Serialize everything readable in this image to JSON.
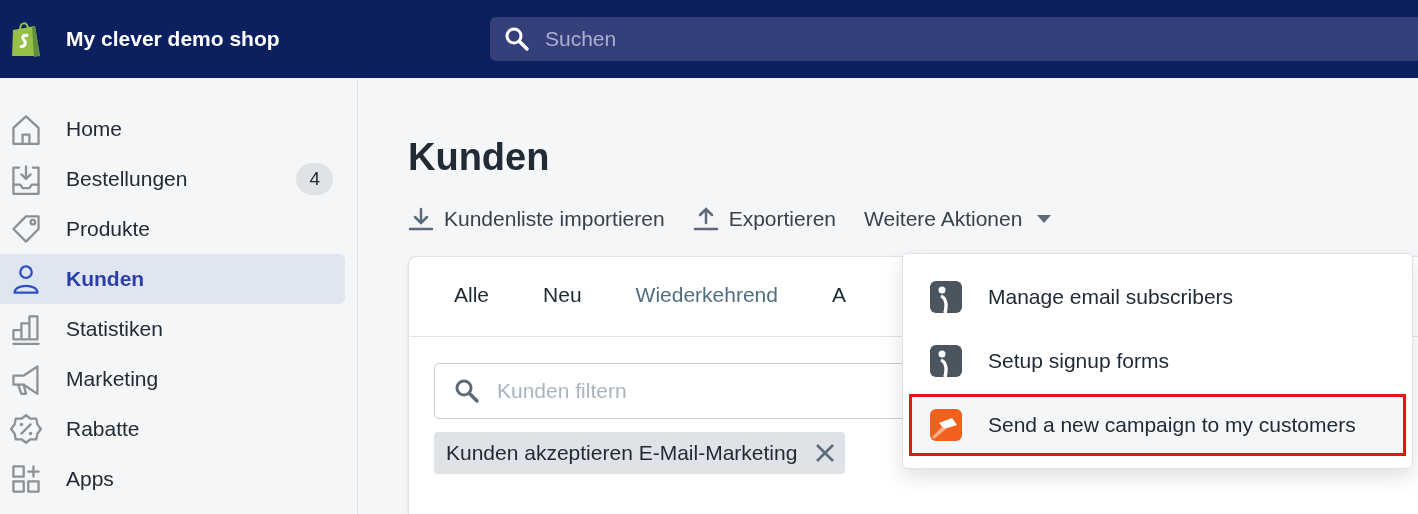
{
  "topbar": {
    "shop_name": "My clever demo shop",
    "search": {
      "placeholder": "Suchen"
    }
  },
  "sidebar": {
    "items": [
      {
        "label": "Home",
        "kind": "home",
        "selected": false
      },
      {
        "label": "Bestellungen",
        "kind": "orders",
        "selected": false,
        "badge": "4"
      },
      {
        "label": "Produkte",
        "kind": "products",
        "selected": false
      },
      {
        "label": "Kunden",
        "kind": "customers",
        "selected": true
      },
      {
        "label": "Statistiken",
        "kind": "stats",
        "selected": false
      },
      {
        "label": "Marketing",
        "kind": "marketing",
        "selected": false
      },
      {
        "label": "Rabatte",
        "kind": "discounts",
        "selected": false
      },
      {
        "label": "Apps",
        "kind": "apps",
        "selected": false
      }
    ]
  },
  "page": {
    "title": "Kunden",
    "actions": [
      {
        "label": "Kundenliste importieren",
        "kind": "import"
      },
      {
        "label": "Exportieren",
        "kind": "export"
      },
      {
        "label": "Weitere Aktionen",
        "kind": "menu"
      }
    ]
  },
  "card": {
    "tabs": [
      {
        "label": "Alle",
        "selected": false
      },
      {
        "label": "Neu",
        "selected": false
      },
      {
        "label": "Wiederkehrend",
        "selected": false
      },
      {
        "label": "A",
        "selected": false
      }
    ],
    "filter": {
      "placeholder": "Kunden filtern"
    },
    "chips": [
      {
        "label": "Kunden akzeptieren E-Mail-Marketing"
      }
    ]
  },
  "dropdown": {
    "items": [
      {
        "label": "Manage email subscribers",
        "kind": "app",
        "highlighted": false
      },
      {
        "label": "Setup signup forms",
        "kind": "app",
        "highlighted": false
      },
      {
        "label": "Send a new campaign to my customers",
        "kind": "campaign",
        "highlighted": true
      }
    ]
  }
}
